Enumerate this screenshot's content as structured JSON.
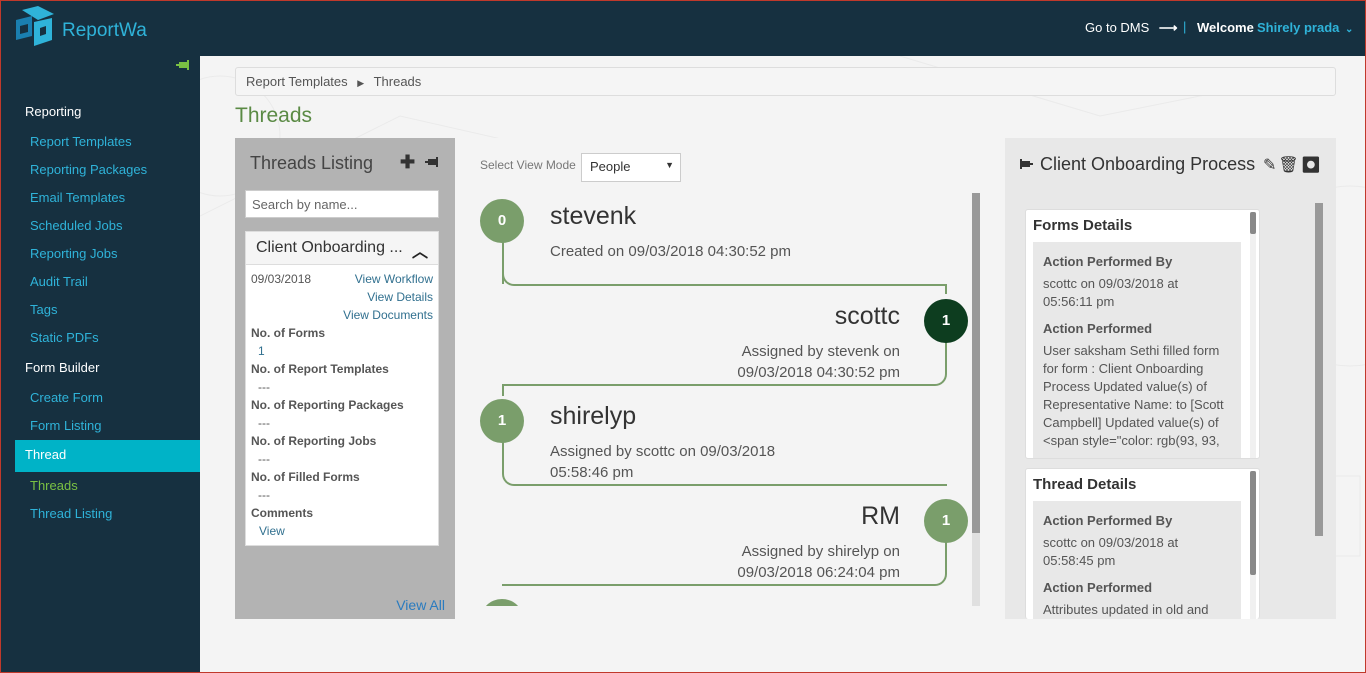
{
  "header": {
    "logo_text": "ReportWa",
    "goto_dms": "Go to DMS",
    "goto_icon": "arrow-right-icon",
    "separator": "|",
    "welcome": "Welcome",
    "user_name": "Shirely prada",
    "colors": {
      "bar": "#163040",
      "accent": "#2fb3d9"
    }
  },
  "sidebar": {
    "sections": [
      {
        "label": "Reporting"
      },
      {
        "label": "Form Builder"
      }
    ],
    "reporting_items": [
      "Report Templates",
      "Reporting Packages",
      "Email Templates",
      "Scheduled Jobs",
      "Reporting Jobs",
      "Audit Trail",
      "Tags",
      "Static PDFs"
    ],
    "form_items": [
      "Create Form",
      "Form Listing"
    ],
    "active": "Thread",
    "thread_items": [
      "Threads",
      "Thread Listing"
    ],
    "colors": {
      "active_bg": "#00b3c7",
      "link": "#2fb3d9",
      "current": "#7ac143"
    }
  },
  "breadcrumb": [
    "Report Templates",
    "Threads"
  ],
  "page_title": "Threads",
  "threads_listing": {
    "title": "Threads Listing",
    "search_placeholder": "Search by name...",
    "card": {
      "title": "Client Onboarding ...",
      "date": "09/03/2018",
      "links": [
        "View Workflow",
        "View Details",
        "View Documents"
      ],
      "fields": [
        {
          "label": "No. of Forms",
          "value": "1"
        },
        {
          "label": "No. of Report Templates",
          "value": "---"
        },
        {
          "label": "No. of Reporting Packages",
          "value": "---"
        },
        {
          "label": "No. of Reporting Jobs",
          "value": "---"
        },
        {
          "label": "No. of Filled Forms",
          "value": "---"
        },
        {
          "label": "Comments",
          "value": "View"
        }
      ]
    },
    "view_all": "View All"
  },
  "view_mode": {
    "label": "Select View Mode",
    "selected": "People"
  },
  "timeline": [
    {
      "step": "0",
      "name": "stevenk",
      "line1": "Created on 09/03/2018 04:30:52 pm",
      "line2": ""
    },
    {
      "step": "1",
      "name": "scottc",
      "line1": "Assigned by stevenk on",
      "line2": "09/03/2018 04:30:52 pm"
    },
    {
      "step": "1",
      "name": "shirelyp",
      "line1": "Assigned by scottc on 09/03/2018",
      "line2": "05:58:46 pm"
    },
    {
      "step": "1",
      "name": "RM",
      "line1": "Assigned by shirelyp on",
      "line2": "09/03/2018 06:24:04 pm"
    }
  ],
  "process": {
    "title": "Client Onboarding Process",
    "icons": [
      "pencil-icon",
      "trash-icon",
      "stop-icon"
    ],
    "forms_details": {
      "title": "Forms Details",
      "by_label": "Action Performed By",
      "by_value": "scottc on 09/03/2018 at 05:56:11 pm",
      "action_label": "Action Performed",
      "action_value": "User saksham Sethi filled form for form : Client Onboarding Process Updated value(s) of Representative Name: to [Scott Campbell] Updated value(s) of <span style=\"color: rgb(93, 93,"
    },
    "thread_details": {
      "title": "Thread Details",
      "by_label": "Action Performed By",
      "by_value": "scottc on 09/03/2018 at 05:58:45 pm",
      "action_label": "Action Performed",
      "action_value": "Attributes updated in old and"
    }
  }
}
